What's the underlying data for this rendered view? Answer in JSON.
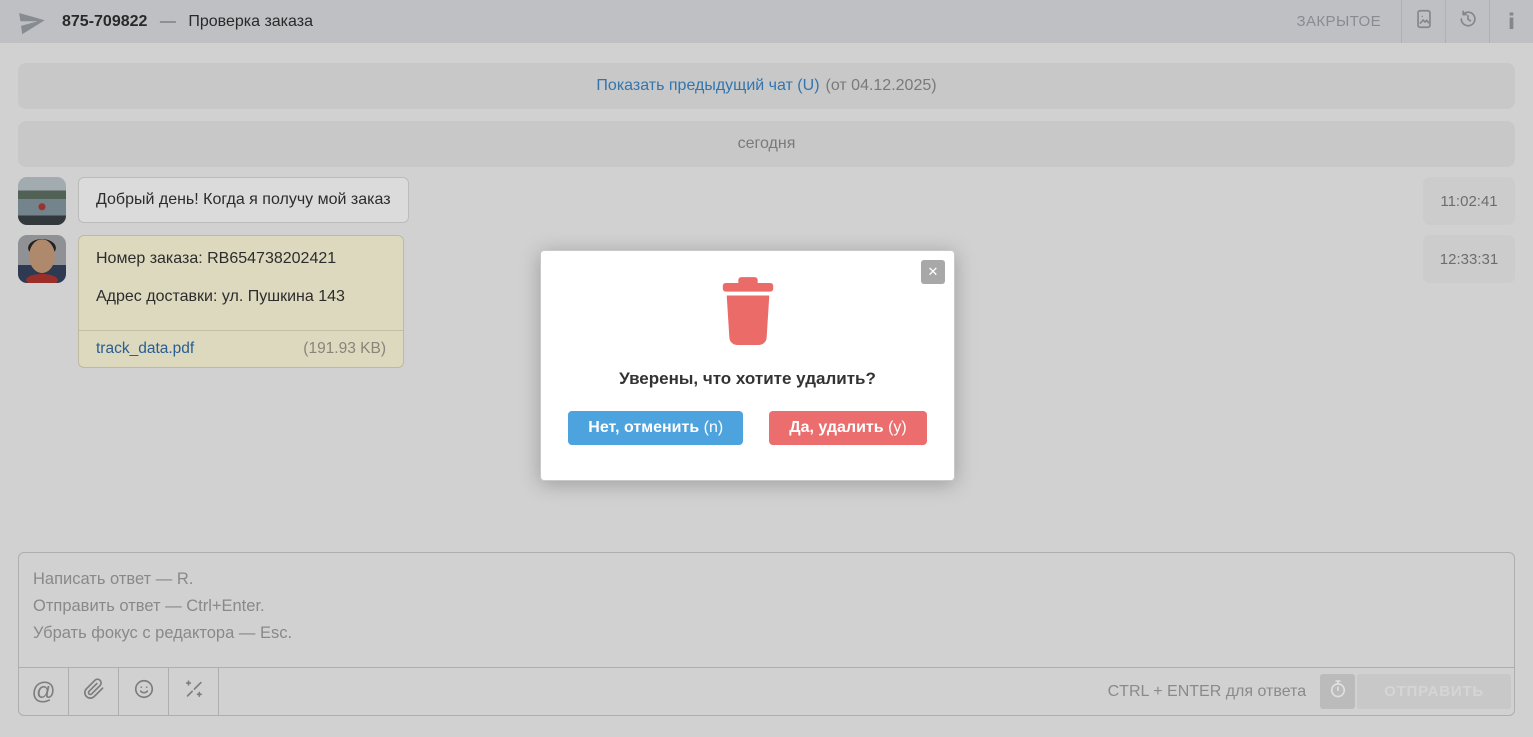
{
  "header": {
    "ticket_id": "875-709822",
    "dash": "—",
    "subject": "Проверка заказа",
    "status": "ЗАКРЫТОЕ"
  },
  "banners": {
    "previous_chat_link": "Показать предыдущий чат (U)",
    "previous_chat_date": "(от 04.12.2025)",
    "today": "сегодня"
  },
  "messages": [
    {
      "text": "Добрый день! Когда я получу мой заказ",
      "time": "11:02:41"
    },
    {
      "lines": [
        "Номер заказа: RB654738202421",
        "Адрес доставки: ул. Пушкина 143"
      ],
      "attachment": {
        "name": "track_data.pdf",
        "size": "(191.93 KB)"
      },
      "time": "12:33:31"
    }
  ],
  "modal": {
    "title": "Уверены, что хотите удалить?",
    "cancel_label": "Нет, отменить",
    "cancel_hotkey": "(n)",
    "confirm_label": "Да, удалить",
    "confirm_hotkey": "(y)"
  },
  "composer": {
    "placeholder_lines": [
      "Написать ответ — R.",
      "Отправить ответ — Ctrl+Enter.",
      "Убрать фокус с редактора — Esc."
    ],
    "hint": "CTRL + ENTER для ответа",
    "send_label": "ОТПРАВИТЬ"
  },
  "icons": {
    "send_plane": "paper-plane",
    "image_file": "file-with-image",
    "history": "history-clock",
    "info": "i",
    "close": "✕",
    "trash": "trash-can",
    "mention": "@",
    "attach": "paperclip",
    "emoji": "smiley",
    "magic_wand": "magic-wand",
    "timer": "stopwatch"
  },
  "colors": {
    "accent_blue": "#4da3de",
    "accent_red": "#eb6d6d",
    "link_blue": "#3a86c8",
    "note_background": "#fcf8da",
    "header_background": "#d9dbdf",
    "page_background": "#eeeeee"
  }
}
